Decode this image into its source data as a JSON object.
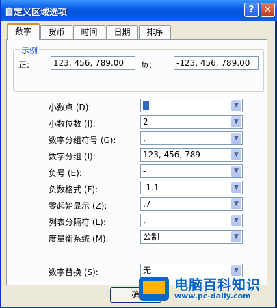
{
  "window": {
    "title": "自定义区域选项",
    "help_glyph": "?",
    "close_glyph": "✕"
  },
  "tabs": [
    {
      "label": "数字",
      "active": true
    },
    {
      "label": "货币",
      "active": false
    },
    {
      "label": "时间",
      "active": false
    },
    {
      "label": "日期",
      "active": false
    },
    {
      "label": "排序",
      "active": false
    }
  ],
  "sample": {
    "group_title": "示例",
    "positive_label": "正:",
    "positive_value": "123, 456, 789.00",
    "negative_label": "负:",
    "negative_value": "-123, 456, 789.00"
  },
  "settings": [
    {
      "label": "小数点 (D):",
      "value": ""
    },
    {
      "label": "小数位数 (I):",
      "value": "2"
    },
    {
      "label": "数字分组符号 (G):",
      "value": ","
    },
    {
      "label": "数字分组 (I):",
      "value": "123, 456, 789"
    },
    {
      "label": "负号 (E):",
      "value": "-"
    },
    {
      "label": "负数格式 (F):",
      "value": "-1.1"
    },
    {
      "label": "零起始显示 (Z):",
      "value": ".7"
    },
    {
      "label": "列表分隔符 (L):",
      "value": ","
    },
    {
      "label": "度量衡系统 (M):",
      "value": "公制"
    },
    {
      "label": "数字替换 (S):",
      "value": "无"
    }
  ],
  "buttons": {
    "ok": "确"
  },
  "watermark": {
    "title": "电脑百科知识",
    "url": "www.pc-daily.com"
  },
  "colors": {
    "titlebar": "#0a5ee8",
    "dialog_bg": "#ece9d8",
    "accent": "#0046d5",
    "watermark": "#0b67c6"
  }
}
